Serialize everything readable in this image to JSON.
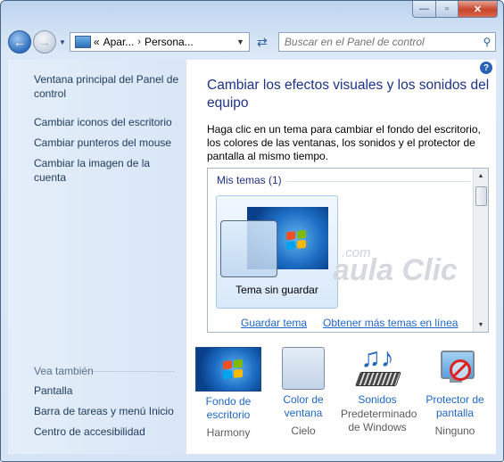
{
  "window": {
    "controls": {
      "minimize": "—",
      "maximize": "▫",
      "close": "✕"
    }
  },
  "nav": {
    "breadcrumb": {
      "prefix": "«",
      "items": [
        "Apar...",
        "Persona..."
      ],
      "separator": "›"
    },
    "search_placeholder": "Buscar en el Panel de control"
  },
  "sidebar": {
    "links": [
      "Ventana principal del Panel de control",
      "Cambiar iconos del escritorio",
      "Cambiar punteros del mouse",
      "Cambiar la imagen de la cuenta"
    ],
    "see_also": {
      "title": "Vea también",
      "links": [
        "Pantalla",
        "Barra de tareas y menú Inicio",
        "Centro de accesibilidad"
      ]
    }
  },
  "main": {
    "help_icon": "?",
    "title": "Cambiar los efectos visuales y los sonidos del equipo",
    "description": "Haga clic en un tema para cambiar el fondo del escritorio, los colores de las ventanas, los sonidos y el protector de pantalla al mismo tiempo.",
    "themes": {
      "group_title": "Mis temas (1)",
      "items": [
        {
          "label": "Tema sin guardar"
        }
      ],
      "save_link": "Guardar tema",
      "more_link": "Obtener más temas en línea",
      "watermark": "aula Clic",
      "watermark_small": ".com"
    },
    "settings": [
      {
        "name": "Fondo de escritorio",
        "value": "Harmony",
        "icon": "wallpaper-icon"
      },
      {
        "name": "Color de ventana",
        "value": "Cielo",
        "icon": "window-color-icon"
      },
      {
        "name": "Sonidos",
        "value": "Predeterminado de Windows",
        "icon": "sounds-icon"
      },
      {
        "name": "Protector de pantalla",
        "value": "Ninguno",
        "icon": "screensaver-icon"
      }
    ]
  },
  "colors": {
    "link": "#1e66c8",
    "title": "#1e3287",
    "close_button": "#c7442b",
    "windows_logo": [
      "#f25022",
      "#7fba00",
      "#00a4ef",
      "#ffb900"
    ]
  }
}
